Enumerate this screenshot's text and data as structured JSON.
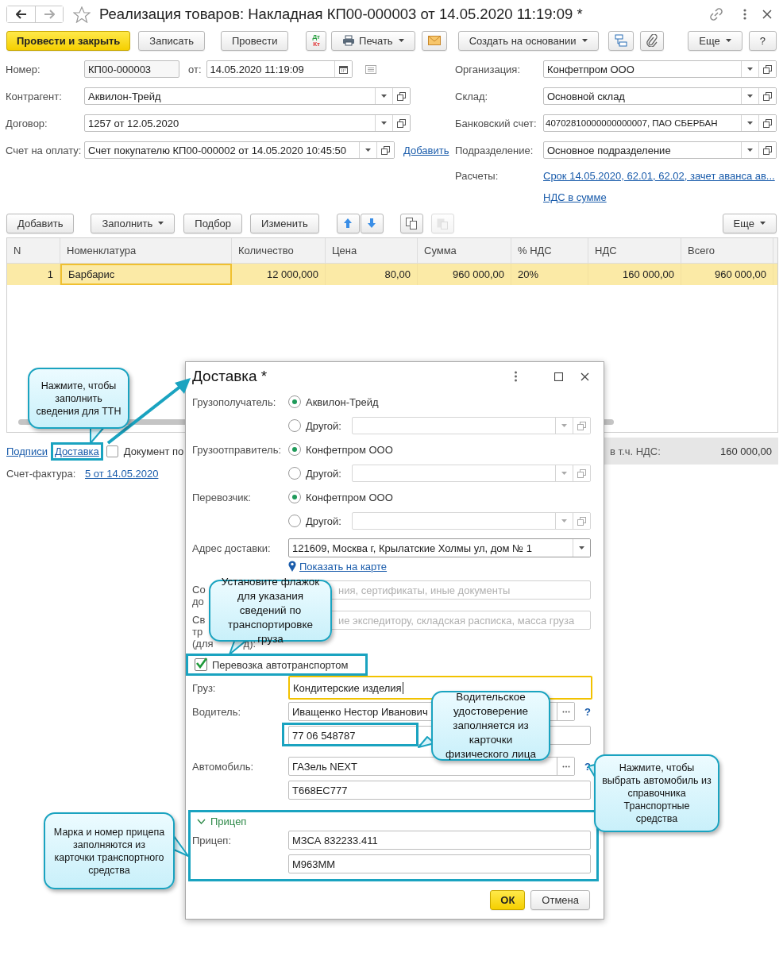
{
  "window": {
    "title": "Реализация товаров: Накладная КП00-000003 от 14.05.2020 11:19:09 *"
  },
  "toolbar": [
    {
      "kind": "primary",
      "label": "Провести и закрыть"
    },
    {
      "kind": "button",
      "label": "Записать"
    },
    {
      "kind": "button",
      "label": "Провести"
    },
    {
      "kind": "dtkt",
      "label": "Дт",
      "sub": "Кт"
    },
    {
      "kind": "print",
      "label": "Печать"
    },
    {
      "kind": "mail"
    },
    {
      "kind": "menu",
      "label": "Создать на основании"
    },
    {
      "kind": "structure"
    },
    {
      "kind": "attach"
    },
    {
      "kind": "menu",
      "label": "Еще"
    },
    {
      "kind": "button",
      "label": "?"
    }
  ],
  "header": {
    "number_label": "Номер:",
    "number": "КП00-000003",
    "date_label": "от:",
    "date": "14.05.2020 11:19:09"
  },
  "left_fields": [
    {
      "label": "Контрагент:",
      "value": "Аквилон-Трейд"
    },
    {
      "label": "Договор:",
      "value": "1257 от 12.05.2020"
    },
    {
      "label": "Счет на оплату:",
      "value": "Счет покупателю КП00-000002 от 14.05.2020 10:45:50",
      "link": "Добавить"
    }
  ],
  "right_fields": [
    {
      "label": "Организация:",
      "value": "Конфетпром ООО"
    },
    {
      "label": "Склад:",
      "value": "Основной склад"
    },
    {
      "label": "Банковский счет:",
      "value": "40702810000000000007, ПАО СБЕРБАН"
    },
    {
      "label": "Подразделение:",
      "value": "Основное подразделение"
    },
    {
      "label": "Расчеты:",
      "links": [
        "Срок 14.05.2020, 62.01, 62.02, зачет аванса ав...",
        "НДС в сумме"
      ]
    }
  ],
  "table_toolbar": [
    {
      "kind": "button",
      "label": "Добавить",
      "disabled": false
    },
    {
      "kind": "menu",
      "label": "Заполнить",
      "disabled": false
    },
    {
      "kind": "button",
      "label": "Подбор",
      "disabled": false
    },
    {
      "kind": "button",
      "label": "Изменить",
      "disabled": false
    },
    {
      "kind": "up",
      "disabled": false
    },
    {
      "kind": "down",
      "disabled": false
    },
    {
      "kind": "copy",
      "disabled": false
    },
    {
      "kind": "paste",
      "disabled": true
    },
    {
      "kind": "menu",
      "label": "Еще",
      "disabled": false
    }
  ],
  "table": {
    "columns": [
      "N",
      "Номенклатура",
      "Количество",
      "Цена",
      "Сумма",
      "% НДС",
      "НДС",
      "Всего"
    ],
    "rows": [
      {
        "selected": true,
        "cells": [
          "1",
          "Барбарис",
          "12 000,000",
          "80,00",
          "960 000,00",
          "20%",
          "160 000,00",
          "960 000,00"
        ]
      }
    ]
  },
  "footer": {
    "links": [
      "Подписи",
      "Доставка"
    ],
    "checkbox": {
      "label": "Документ по",
      "checked": false
    },
    "vat_label": "в т.ч. НДС:",
    "vat_value": "160 000,00",
    "invoice_label": "Счет-фактура:",
    "invoice_link": "5 от 14.05.2020"
  },
  "dialog": {
    "title": "Доставка *",
    "parties": [
      {
        "label": "Грузополучатель:",
        "options": [
          {
            "kind": "plain",
            "label": "Аквилон-Трейд",
            "selected": true
          },
          {
            "kind": "field",
            "label": "Другой:",
            "selected": false
          }
        ]
      },
      {
        "label": "Грузоотправитель:",
        "options": [
          {
            "kind": "plain",
            "label": "Конфетпром ООО",
            "selected": true
          },
          {
            "kind": "field",
            "label": "Другой:",
            "selected": false
          }
        ]
      },
      {
        "label": "Перевозчик:",
        "options": [
          {
            "kind": "plain",
            "label": "Конфетпром ООО",
            "selected": true
          },
          {
            "kind": "field",
            "label": "Другой:",
            "selected": false
          }
        ]
      }
    ],
    "address": {
      "label": "Адрес доставки:",
      "value": "121609, Москва г, Крылатские Холмы ул, дом № 1",
      "map_link": "Показать на карте"
    },
    "documents": [
      {
        "label_lines": [
          "Со",
          "до"
        ],
        "placeholder": "ния, сертификаты, иные документы"
      },
      {
        "label_lines": [
          "Св",
          "тр",
          "(для",
          "д):"
        ],
        "placeholder": "ие экспедитору, складская расписка, масса груза"
      }
    ],
    "transport": {
      "label": "Перевозка автотранспортом",
      "checked": true
    },
    "cargo": {
      "label": "Груз:",
      "value": "Кондитерские изделия",
      "focused": true
    },
    "driver": {
      "label": "Водитель:",
      "value": "Иващенко Нестор Иванович",
      "help": "?",
      "license": "77 06 548787"
    },
    "vehicle": {
      "label": "Автомобиль:",
      "value": "ГАЗель NEXT",
      "help": "?",
      "number": "Т668ЕС777"
    },
    "trailer": {
      "title": "Прицеп",
      "expanded": true,
      "label": "Прицеп:",
      "model": "МЗСА 832233.411",
      "number": "М963ММ"
    },
    "buttons": [
      {
        "kind": "default",
        "label": "ОК"
      },
      {
        "kind": "normal",
        "label": "Отмена"
      }
    ]
  },
  "callouts": [
    {
      "text": "Нажмите, чтобы заполнить сведения для ТТН"
    },
    {
      "text": "Установите флажок для указания сведений по транспортировке груза"
    },
    {
      "text": "Водительское удостоверение заполняется из карточки физического лица"
    },
    {
      "text": "Нажмите, чтобы выбрать автомобиль из справочника Транспортные средства"
    },
    {
      "text": "Марка и номер прицепа заполняются из карточки транспортного средства"
    }
  ]
}
